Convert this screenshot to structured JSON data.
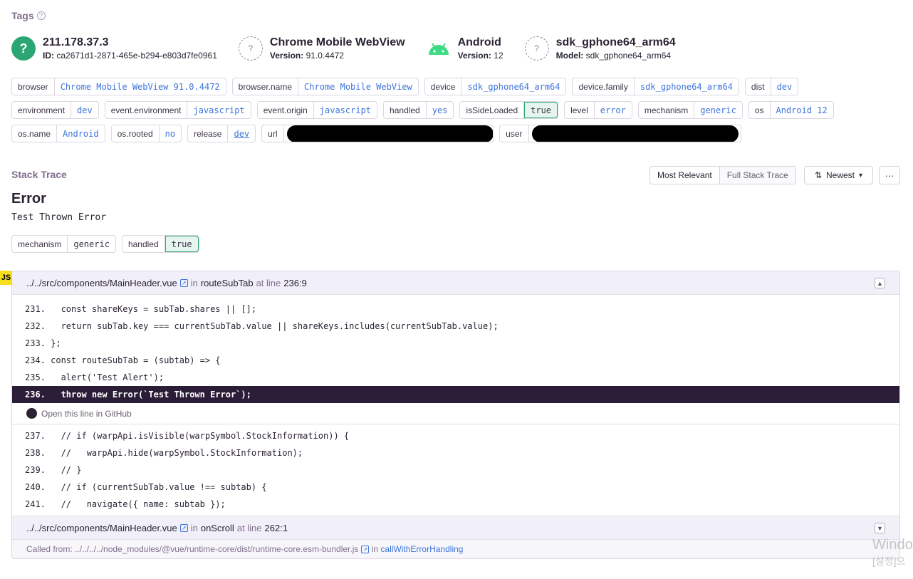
{
  "tags_title": "Tags",
  "context": [
    {
      "title": "211.178.37.3",
      "sub_label": "ID:",
      "sub_value": "ca2671d1-2871-465e-b294-e803d7fe0961",
      "icon": "question-circle-icon"
    },
    {
      "title": "Chrome Mobile WebView",
      "sub_label": "Version:",
      "sub_value": "91.0.4472",
      "icon": "unknown-icon"
    },
    {
      "title": "Android",
      "sub_label": "Version:",
      "sub_value": "12",
      "icon": "android-icon"
    },
    {
      "title": "sdk_gphone64_arm64",
      "sub_label": "Model:",
      "sub_value": "sdk_gphone64_arm64",
      "icon": "unknown-icon"
    }
  ],
  "tags": {
    "row1": [
      {
        "k": "browser",
        "v": "Chrome Mobile WebView 91.0.4472"
      },
      {
        "k": "browser.name",
        "v": "Chrome Mobile WebView"
      },
      {
        "k": "device",
        "v": "sdk_gphone64_arm64"
      },
      {
        "k": "device.family",
        "v": "sdk_gphone64_arm64"
      },
      {
        "k": "dist",
        "v": "dev"
      }
    ],
    "row2": [
      {
        "k": "environment",
        "v": "dev"
      },
      {
        "k": "event.environment",
        "v": "javascript"
      },
      {
        "k": "event.origin",
        "v": "javascript"
      },
      {
        "k": "handled",
        "v": "yes"
      },
      {
        "k": "isSideLoaded",
        "v": "true"
      },
      {
        "k": "level",
        "v": "error"
      },
      {
        "k": "mechanism",
        "v": "generic"
      },
      {
        "k": "os",
        "v": "Android 12"
      }
    ],
    "row3": [
      {
        "k": "os.name",
        "v": "Android"
      },
      {
        "k": "os.rooted",
        "v": "no"
      },
      {
        "k": "release",
        "v": "dev"
      },
      {
        "k": "url",
        "v": ""
      },
      {
        "k": "user",
        "v": ""
      }
    ]
  },
  "stack_trace": {
    "title": "Stack Trace",
    "view_options": [
      "Most Relevant",
      "Full Stack Trace"
    ],
    "sort_label": "Newest",
    "more_label": "···"
  },
  "error": {
    "type": "Error",
    "value": "Test Thrown Error",
    "mechanism_tags": [
      {
        "k": "mechanism",
        "v": "generic"
      },
      {
        "k": "handled",
        "v": "true"
      }
    ]
  },
  "platform_badge": "JS",
  "frames": [
    {
      "file": "../../src/components/MainHeader.vue",
      "in_label": "in",
      "function": "routeSubTab",
      "at_label": "at line",
      "line": "236:9",
      "code_before": [
        "231.   const shareKeys = subTab.shares || [];",
        "232.   return subTab.key === currentSubTab.value || shareKeys.includes(currentSubTab.value);",
        "233. };",
        "234. const routeSubTab = (subtab) => {",
        "235.   alert('Test Alert');"
      ],
      "active_line": "236.   throw new Error(`Test Thrown Error`);",
      "github_label": "Open this line in GitHub",
      "code_after": [
        "237.   // if (warpApi.isVisible(warpSymbol.StockInformation)) {",
        "238.   //   warpApi.hide(warpSymbol.StockInformation);",
        "239.   // }",
        "240.   // if (currentSubTab.value !== subtab) {",
        "241.   //   navigate({ name: subtab });"
      ]
    },
    {
      "file": "../../src/components/MainHeader.vue",
      "in_label": "in",
      "function": "onScroll",
      "at_label": "at line",
      "line": "262:1",
      "called_prefix": "Called from:",
      "called_file": "../../../../node_modules/@vue/runtime-core/dist/runtime-core.esm-bundler.js",
      "called_in": "in",
      "called_fn": "callWithErrorHandling"
    }
  ],
  "watermark": {
    "line1": "Windo",
    "line2": "[설정]으"
  }
}
